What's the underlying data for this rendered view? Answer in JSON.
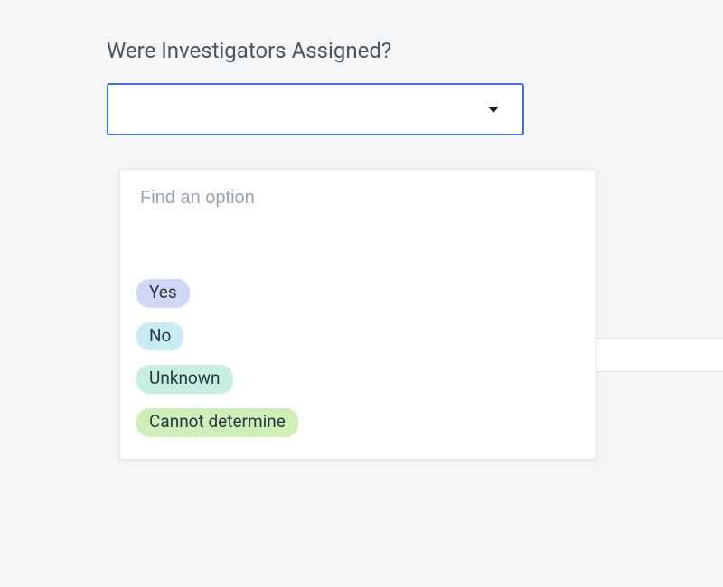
{
  "field": {
    "label": "Were Investigators Assigned?",
    "selected_value": ""
  },
  "dropdown": {
    "search_placeholder": "Find an option",
    "options": [
      {
        "label": "Yes",
        "bg": "#cfd8f7"
      },
      {
        "label": "No",
        "bg": "#c7ecf5"
      },
      {
        "label": "Unknown",
        "bg": "#c4efe1"
      },
      {
        "label": "Cannot determine",
        "bg": "#cdefb8"
      }
    ]
  },
  "colors": {
    "focus_border": "#3b6ef0",
    "page_bg": "#f5f6f7"
  }
}
